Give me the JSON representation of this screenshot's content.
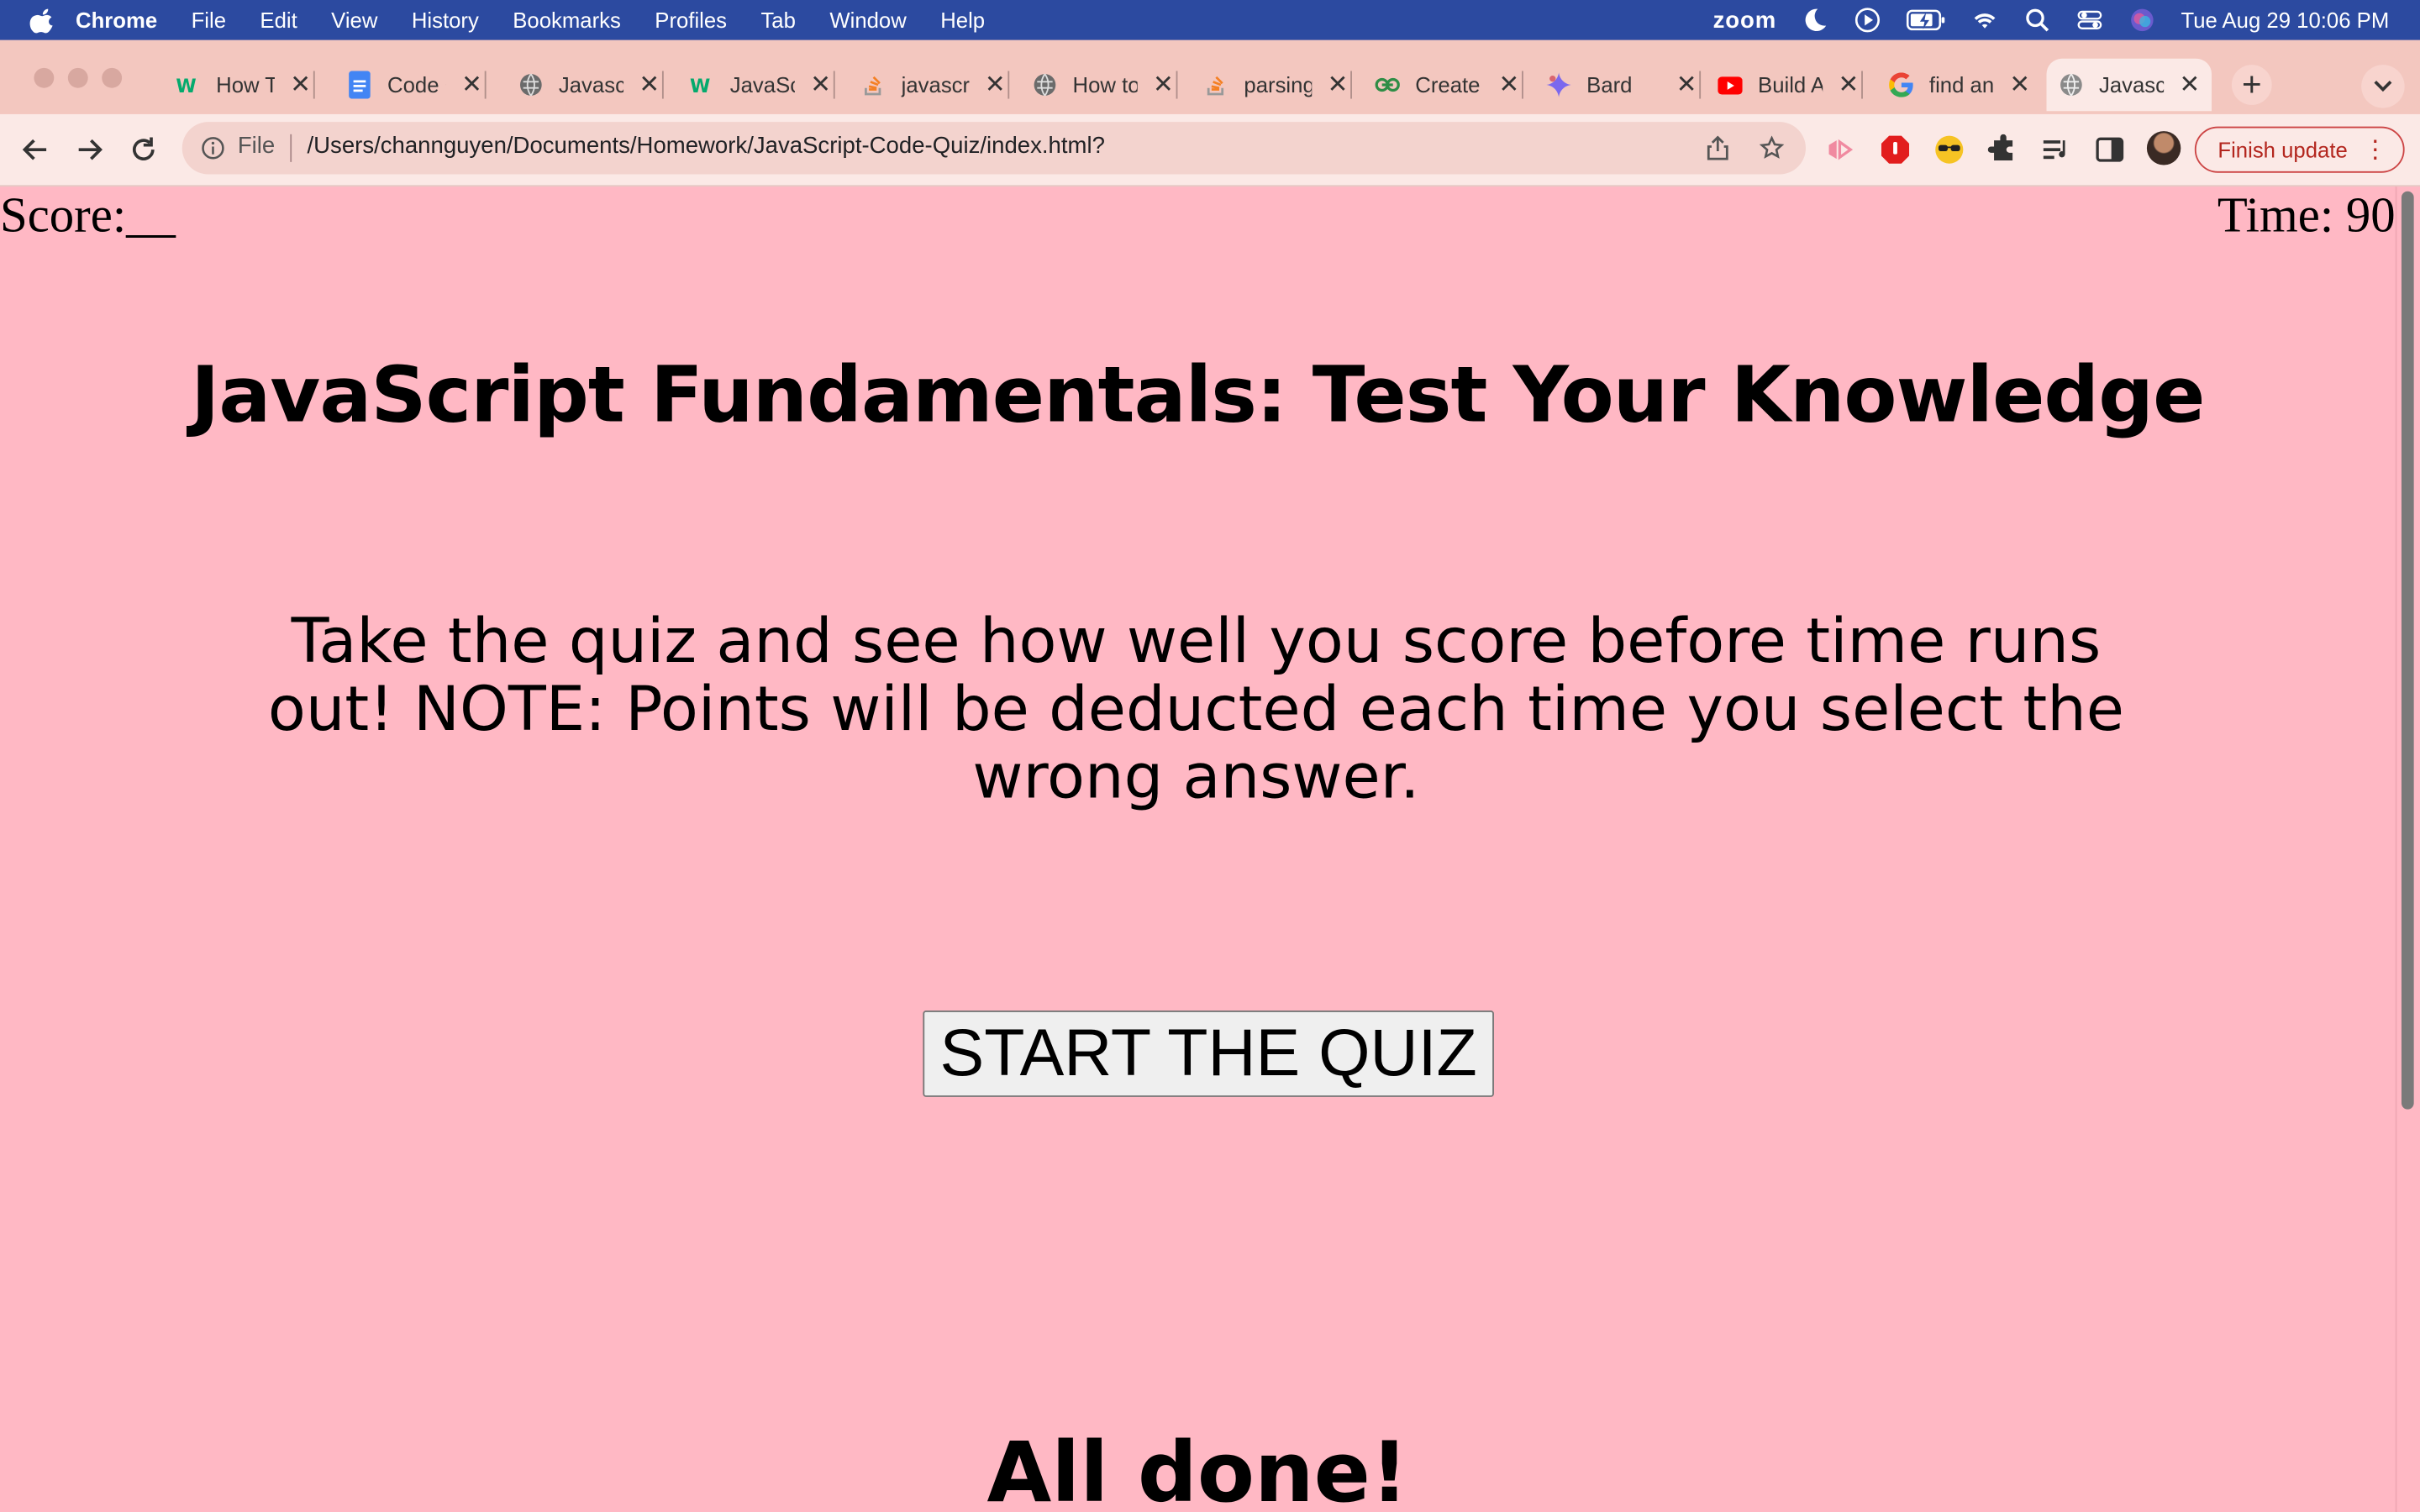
{
  "menubar": {
    "app": "Chrome",
    "items": [
      "File",
      "Edit",
      "View",
      "History",
      "Bookmarks",
      "Profiles",
      "Tab",
      "Window",
      "Help"
    ],
    "zoom_label": "zoom",
    "datetime": "Tue Aug 29  10:06 PM"
  },
  "tabs": [
    {
      "label": "How To",
      "icon": "w3schools-icon"
    },
    {
      "label": "Code C",
      "icon": "google-docs-icon"
    },
    {
      "label": "Javasc",
      "icon": "globe-icon"
    },
    {
      "label": "JavaSc",
      "icon": "w3schools-icon"
    },
    {
      "label": "javascr",
      "icon": "stackoverflow-icon"
    },
    {
      "label": "How to",
      "icon": "globe-icon"
    },
    {
      "label": "parsing",
      "icon": "stackoverflow-icon"
    },
    {
      "label": "Create",
      "icon": "geeksforgeeks-icon"
    },
    {
      "label": "Bard",
      "icon": "bard-icon"
    },
    {
      "label": "Build A",
      "icon": "youtube-icon"
    },
    {
      "label": "find an",
      "icon": "google-icon"
    },
    {
      "label": "Javasc",
      "icon": "globe-icon",
      "active": true
    }
  ],
  "address_bar": {
    "scheme_label": "File",
    "url": "/Users/channguyen/Documents/Homework/JavaScript-Code-Quiz/index.html?"
  },
  "toolbar": {
    "finish_update_label": "Finish update"
  },
  "page": {
    "score_label": "Score:__",
    "time_label": "Time: 90",
    "title": "JavaScript Fundamentals: Test Your Knowledge",
    "description": "Take the quiz and see how well you score before time runs out! NOTE: Points will be deducted each time you select the wrong answer.",
    "start_button": "START THE QUIZ",
    "all_done": "All done!"
  },
  "colors": {
    "page_background": "#ffb8c4",
    "tabstrip_background": "#f3c7bf",
    "menubar_background": "#2c4aa0",
    "finish_update_accent": "#b3261e"
  }
}
